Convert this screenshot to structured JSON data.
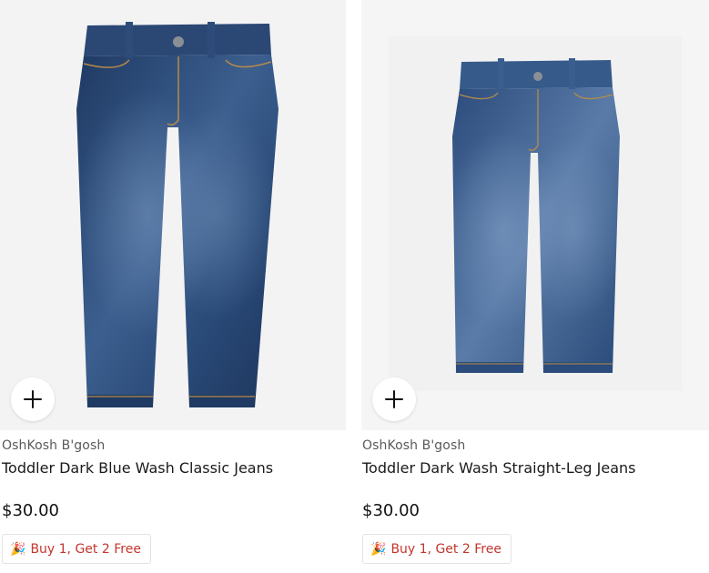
{
  "products": [
    {
      "brand": "OshKosh B'gosh",
      "title": "Toddler Dark Blue Wash Classic Jeans",
      "price": "$30.00",
      "promo": "Buy 1, Get 2 Free",
      "promo_icon": "party-popper-icon",
      "image": "dark-blue-wash-jeans",
      "add_icon": "plus-icon"
    },
    {
      "brand": "OshKosh B'gosh",
      "title": "Toddler Dark Wash Straight-Leg Jeans",
      "price": "$30.00",
      "promo": "Buy 1, Get 2 Free",
      "promo_icon": "party-popper-icon",
      "image": "dark-wash-straight-leg-jeans",
      "add_icon": "plus-icon"
    }
  ],
  "colors": {
    "promo_text": "#c4362c",
    "denim_dark": "#23406b",
    "denim_light": "#4a6e9c"
  }
}
